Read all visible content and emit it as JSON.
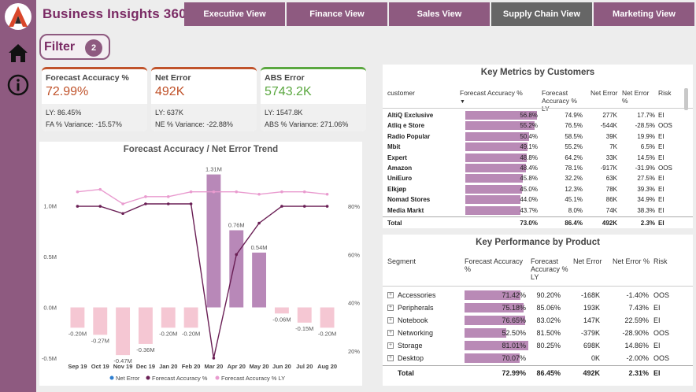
{
  "header": {
    "title": "Business Insights 360",
    "tabs": [
      {
        "label": "Executive View",
        "active": false
      },
      {
        "label": "Finance View",
        "active": false
      },
      {
        "label": "Sales View",
        "active": false
      },
      {
        "label": "Supply Chain View",
        "active": true
      },
      {
        "label": "Marketing View",
        "active": false
      }
    ]
  },
  "sidebar": {
    "icons": [
      "logo-icon",
      "home-icon",
      "info-icon"
    ]
  },
  "filter": {
    "label": "Filter",
    "count": "2"
  },
  "kpis": [
    {
      "title": "Forecast Accuracy %",
      "value": "72.99%",
      "value_color": "#c0532b",
      "accent": "#c0532b",
      "ly": "LY: 86.45%",
      "variance": "FA % Variance: -15.57%"
    },
    {
      "title": "Net Error",
      "value": "492K",
      "value_color": "#c0532b",
      "accent": "#c0532b",
      "ly": "LY: 637K",
      "variance": "NE % Variance: -22.88%"
    },
    {
      "title": "ABS Error",
      "value": "5743.2K",
      "value_color": "#5aa73f",
      "accent": "#5aa73f",
      "ly": "LY: 1547.8K",
      "variance": "ABS % Variance: 271.06%"
    }
  ],
  "trend": {
    "title": "Forecast Accuracy / Net Error Trend",
    "legend": [
      "Net Error",
      "Forecast Accuracy %",
      "Forecast Accuracy % LY"
    ]
  },
  "chart_data": {
    "type": "bar",
    "title": "Forecast Accuracy / Net Error Trend",
    "categories": [
      "Sep 19",
      "Oct 19",
      "Nov 19",
      "Dec 19",
      "Jan 20",
      "Feb 20",
      "Mar 20",
      "Apr 20",
      "May 20",
      "Jun 20",
      "Jul 20",
      "Aug 20"
    ],
    "y_ticks": [
      "-0.5M",
      "0.0M",
      "0.5M",
      "1.0M"
    ],
    "y2_ticks": [
      "20%",
      "40%",
      "60%",
      "80%"
    ],
    "ylim": [
      -0.5,
      1.4
    ],
    "y2lim": [
      17,
      97
    ],
    "series": [
      {
        "name": "Net Error",
        "kind": "bar",
        "values": [
          -0.2,
          -0.27,
          -0.47,
          -0.36,
          -0.2,
          -0.2,
          1.31,
          0.76,
          0.54,
          -0.06,
          -0.15,
          -0.2
        ],
        "labels": [
          "-0.20M",
          "-0.27M",
          "-0.47M",
          "-0.36M",
          "-0.20M",
          "-0.20M",
          "1.31M",
          "0.76M",
          "0.54M",
          "-0.06M",
          "-0.15M",
          "-0.20M"
        ],
        "positive_color": "#b888b8",
        "negative_color": "#f5c7d3"
      },
      {
        "name": "Forecast Accuracy %",
        "kind": "line",
        "color": "#6a1f55",
        "values": [
          80,
          80,
          77,
          81,
          81,
          81,
          17,
          60,
          73,
          80,
          80,
          80
        ]
      },
      {
        "name": "Forecast Accuracy % LY",
        "kind": "line",
        "color": "#e99bcf",
        "values": [
          86,
          87,
          81,
          84,
          84,
          86,
          86,
          86,
          85,
          86,
          86,
          85
        ]
      }
    ]
  },
  "customers": {
    "title": "Key Metrics by Customers",
    "columns": [
      "customer",
      "Forecast Accuracy %",
      "Forecast Accuracy % LY",
      "Net Error",
      "Net Error %",
      "Risk"
    ],
    "rows": [
      {
        "name": "AltiQ Exclusive",
        "fa": "56.8%",
        "fa_frac": 0.568,
        "fa_ly": "74.9%",
        "ne": "277K",
        "nep": "17.7%",
        "risk": "EI"
      },
      {
        "name": "Atliq e Store",
        "fa": "55.2%",
        "fa_frac": 0.552,
        "fa_ly": "76.5%",
        "ne": "-544K",
        "nep": "-28.5%",
        "risk": "OOS"
      },
      {
        "name": "Radio Popular",
        "fa": "50.4%",
        "fa_frac": 0.504,
        "fa_ly": "58.5%",
        "ne": "39K",
        "nep": "19.9%",
        "risk": "EI"
      },
      {
        "name": "Mbit",
        "fa": "49.1%",
        "fa_frac": 0.491,
        "fa_ly": "55.2%",
        "ne": "7K",
        "nep": "6.5%",
        "risk": "EI"
      },
      {
        "name": "Expert",
        "fa": "48.8%",
        "fa_frac": 0.488,
        "fa_ly": "64.2%",
        "ne": "33K",
        "nep": "14.5%",
        "risk": "EI"
      },
      {
        "name": "Amazon",
        "fa": "48.4%",
        "fa_frac": 0.484,
        "fa_ly": "78.1%",
        "ne": "-917K",
        "nep": "-31.9%",
        "risk": "OOS"
      },
      {
        "name": "UniEuro",
        "fa": "45.8%",
        "fa_frac": 0.458,
        "fa_ly": "32.2%",
        "ne": "63K",
        "nep": "27.5%",
        "risk": "EI"
      },
      {
        "name": "Elkjøp",
        "fa": "45.0%",
        "fa_frac": 0.45,
        "fa_ly": "12.3%",
        "ne": "78K",
        "nep": "39.3%",
        "risk": "EI"
      },
      {
        "name": "Nomad Stores",
        "fa": "44.0%",
        "fa_frac": 0.44,
        "fa_ly": "45.1%",
        "ne": "86K",
        "nep": "34.9%",
        "risk": "EI"
      },
      {
        "name": "Media Markt",
        "fa": "43.7%",
        "fa_frac": 0.437,
        "fa_ly": "8.0%",
        "ne": "74K",
        "nep": "38.3%",
        "risk": "EI"
      }
    ],
    "total": {
      "name": "Total",
      "fa": "73.0%",
      "fa_ly": "86.4%",
      "ne": "492K",
      "nep": "2.3%",
      "risk": "EI"
    }
  },
  "products": {
    "title": "Key Performance by Product",
    "columns": [
      "Segment",
      "Forecast Accuracy %",
      "Forecast Accuracy % LY",
      "Net Error",
      "Net Error %",
      "Risk"
    ],
    "rows": [
      {
        "name": "Accessories",
        "fa": "71.42%",
        "fa_frac": 0.7142,
        "fa_ly": "90.20%",
        "ne": "-168K",
        "nep": "-1.40%",
        "risk": "OOS"
      },
      {
        "name": "Peripherals",
        "fa": "75.18%",
        "fa_frac": 0.7518,
        "fa_ly": "85.06%",
        "ne": "193K",
        "nep": "7.43%",
        "risk": "EI"
      },
      {
        "name": "Notebook",
        "fa": "76.65%",
        "fa_frac": 0.7665,
        "fa_ly": "83.02%",
        "ne": "147K",
        "nep": "22.59%",
        "risk": "EI"
      },
      {
        "name": "Networking",
        "fa": "52.50%",
        "fa_frac": 0.525,
        "fa_ly": "81.50%",
        "ne": "-379K",
        "nep": "-28.90%",
        "risk": "OOS"
      },
      {
        "name": "Storage",
        "fa": "81.01%",
        "fa_frac": 0.8101,
        "fa_ly": "80.25%",
        "ne": "698K",
        "nep": "14.86%",
        "risk": "EI"
      },
      {
        "name": "Desktop",
        "fa": "70.07%",
        "fa_frac": 0.7007,
        "fa_ly": "",
        "ne": "0K",
        "nep": "-2.00%",
        "risk": "OOS"
      }
    ],
    "total": {
      "name": "Total",
      "fa": "72.99%",
      "fa_ly": "86.45%",
      "ne": "492K",
      "nep": "2.31%",
      "risk": "EI"
    }
  }
}
